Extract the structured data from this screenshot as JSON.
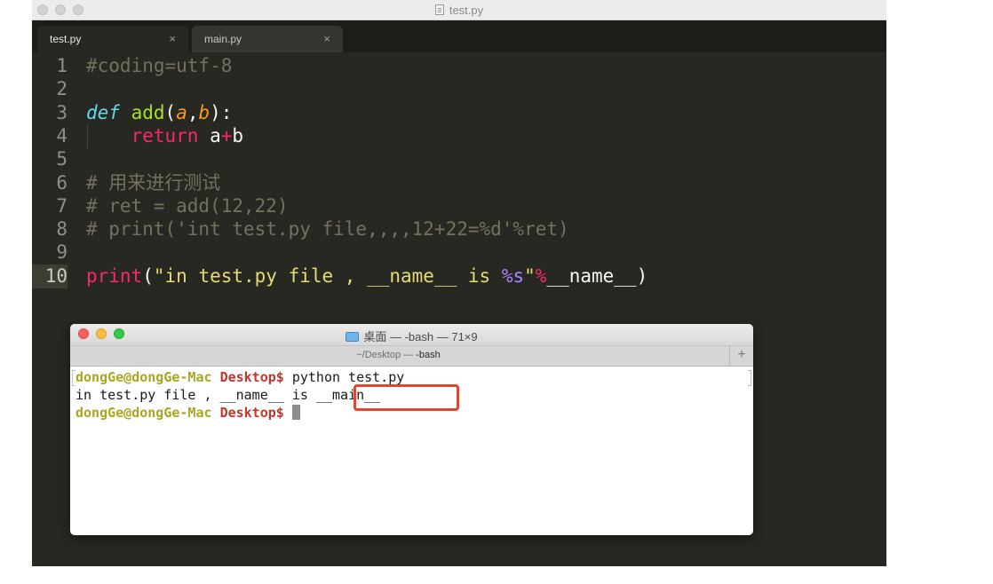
{
  "editor": {
    "window_title": "test.py",
    "tabs": [
      {
        "label": "test.py",
        "close": "×",
        "active": true
      },
      {
        "label": "main.py",
        "close": "×",
        "active": false
      }
    ],
    "lines": [
      {
        "number": "1",
        "segments": [
          {
            "text": "#coding=utf-8",
            "cls": "cm"
          }
        ]
      },
      {
        "number": "2",
        "segments": []
      },
      {
        "number": "3",
        "segments": [
          {
            "text": "def",
            "cls": "kw-def"
          },
          {
            "text": " ",
            "cls": ""
          },
          {
            "text": "add",
            "cls": "fn"
          },
          {
            "text": "(",
            "cls": ""
          },
          {
            "text": "a",
            "cls": "param"
          },
          {
            "text": ",",
            "cls": ""
          },
          {
            "text": "b",
            "cls": "param"
          },
          {
            "text": "):",
            "cls": ""
          }
        ]
      },
      {
        "number": "4",
        "indent": true,
        "segments": [
          {
            "text": "    ",
            "cls": ""
          },
          {
            "text": "return",
            "cls": "kw"
          },
          {
            "text": " a",
            "cls": ""
          },
          {
            "text": "+",
            "cls": "op"
          },
          {
            "text": "b",
            "cls": ""
          }
        ]
      },
      {
        "number": "5",
        "segments": []
      },
      {
        "number": "6",
        "segments": [
          {
            "text": "# 用来进行测试",
            "cls": "cm"
          }
        ]
      },
      {
        "number": "7",
        "segments": [
          {
            "text": "# ret = add(12,22)",
            "cls": "cm"
          }
        ]
      },
      {
        "number": "8",
        "segments": [
          {
            "text": "# print('int test.py file,,,,12+22=%d'%ret)",
            "cls": "cm"
          }
        ]
      },
      {
        "number": "9",
        "segments": []
      },
      {
        "number": "10",
        "current": true,
        "segments": [
          {
            "text": "print",
            "cls": "kw"
          },
          {
            "text": "(",
            "cls": ""
          },
          {
            "text": "\"in test.py file , __name__ is ",
            "cls": "str"
          },
          {
            "text": "%s",
            "cls": "fmt"
          },
          {
            "text": "\"",
            "cls": "str"
          },
          {
            "text": "%",
            "cls": "op"
          },
          {
            "text": "__name__)",
            "cls": ""
          }
        ]
      }
    ]
  },
  "terminal": {
    "title": "桌面 — -bash — 71×9",
    "tab_path": "~/Desktop — ",
    "tab_process": "-bash",
    "plus_label": "+",
    "line1": {
      "user": "dongGe@dongGe-Mac",
      "dir": "Desktop$",
      "command": " python test.py"
    },
    "line2": {
      "output": "in test.py file , __name__ is __main__"
    },
    "line3": {
      "user": "dongGe@dongGe-Mac",
      "dir": "Desktop$",
      "command": " "
    },
    "highlight_color": "#e0462b"
  },
  "colors": {
    "editor_bg": "#272822",
    "comment": "#75715e",
    "keyword": "#f92672",
    "function": "#a6e22e",
    "string": "#e6db74",
    "param": "#fd971f"
  }
}
